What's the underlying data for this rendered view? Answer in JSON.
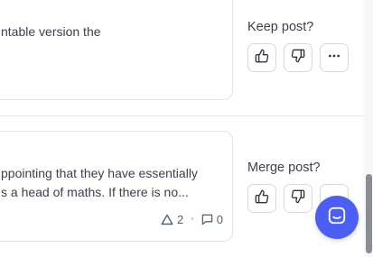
{
  "post1": {
    "snippet_line1": "ntable version the",
    "action_label": "Keep post?"
  },
  "post2": {
    "snippet_line1": "ppointing that they have essentially",
    "snippet_line2": "s a head of maths. If there is no...",
    "upvotes": "2",
    "comments": "0",
    "action_label": "Merge post?"
  },
  "icons": {
    "thumbs_up": "thumbs-up-icon",
    "thumbs_down": "thumbs-down-icon",
    "more": "ellipsis-icon",
    "chat": "chat-icon"
  },
  "colors": {
    "accent": "#4c5ff5",
    "border": "#e1e3e8"
  }
}
